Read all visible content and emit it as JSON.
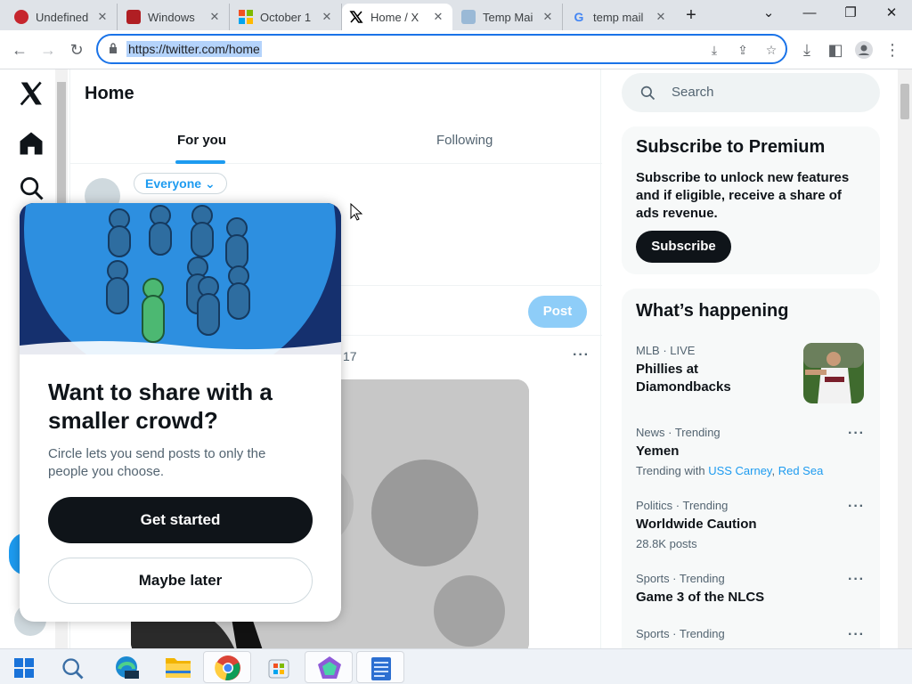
{
  "browser": {
    "tabs": [
      {
        "title": "Undefined"
      },
      {
        "title": "Windows"
      },
      {
        "title": "October 1"
      },
      {
        "title": "Home / X"
      },
      {
        "title": "Temp Mai"
      },
      {
        "title": "temp mail"
      }
    ],
    "new_tab_label": "+",
    "url": "https://twitter.com/home"
  },
  "twitter": {
    "page_title": "Home",
    "feed_tabs": [
      {
        "label": "For you"
      },
      {
        "label": "Following"
      }
    ],
    "audience_label": "Everyone",
    "post_button": "Post",
    "timestamp_fragment": "17",
    "search_placeholder": "Search",
    "premium": {
      "title": "Subscribe to Premium",
      "text": "Subscribe to unlock new features and if eligible, receive a share of ads revenue.",
      "button": "Subscribe"
    },
    "happening": {
      "title": "What’s happening",
      "items": [
        {
          "meta": "MLB · LIVE",
          "name": "Phillies at Diamondbacks"
        },
        {
          "meta": "News · Trending",
          "name": "Yemen",
          "with_prefix": "Trending with",
          "with_links": [
            "USS Carney",
            "Red Sea"
          ]
        },
        {
          "meta": "Politics · Trending",
          "name": "Worldwide Caution",
          "count": "28.8K posts"
        },
        {
          "meta": "Sports · Trending",
          "name": "Game 3 of the NLCS"
        },
        {
          "meta": "Sports · Trending",
          "name": ""
        }
      ]
    }
  },
  "modal": {
    "title": "Want to share with a smaller crowd?",
    "description": "Circle lets you send posts to only the people you choose.",
    "primary_button": "Get started",
    "secondary_button": "Maybe later"
  },
  "colors": {
    "accent": "#1d9bf0",
    "post_disabled": "#8ecdf8",
    "dark": "#0f1419"
  }
}
